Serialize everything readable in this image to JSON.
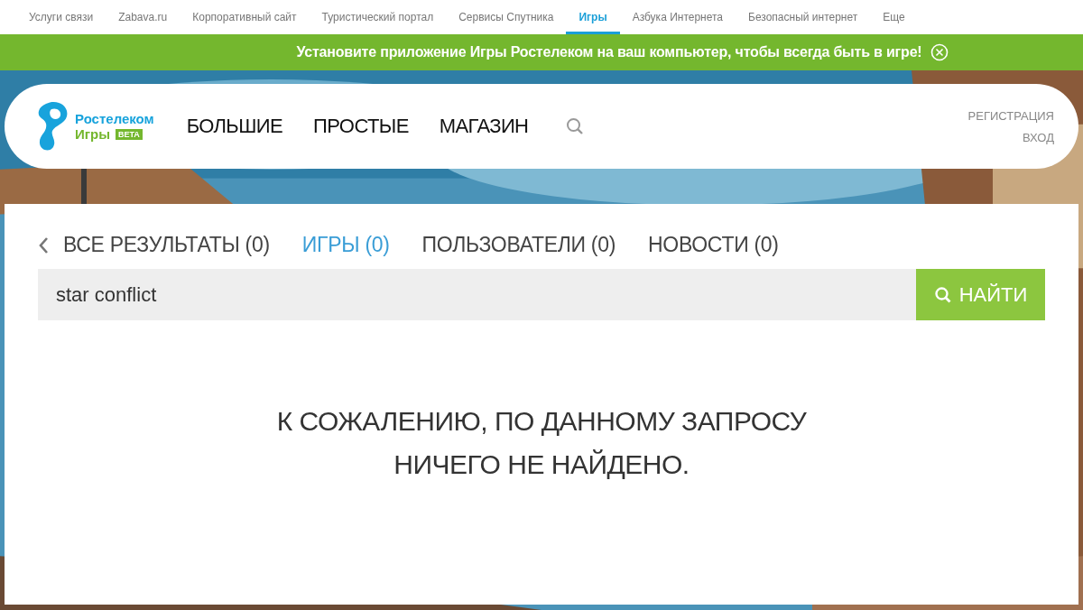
{
  "top_nav": [
    {
      "label": "Услуги связи",
      "selected": false
    },
    {
      "label": "Zabava.ru",
      "selected": false
    },
    {
      "label": "Корпоративный сайт",
      "selected": false
    },
    {
      "label": "Туристический портал",
      "selected": false
    },
    {
      "label": "Сервисы Спутника",
      "selected": false
    },
    {
      "label": "Игры",
      "selected": true
    },
    {
      "label": "Азбука Интернета",
      "selected": false
    },
    {
      "label": "Безопасный интернет",
      "selected": false
    },
    {
      "label": "Еще",
      "selected": false
    }
  ],
  "banner": {
    "text": "Установите приложение Игры Ростелеком на ваш компьютер, чтобы всегда быть в игре!"
  },
  "header": {
    "logo": {
      "brand": "Ростелеком",
      "product": "Игры",
      "badge": "BETA"
    },
    "menu": [
      "БОЛЬШИЕ",
      "ПРОСТЫЕ",
      "МАГАЗИН"
    ],
    "auth": [
      "РЕГИСТРАЦИЯ",
      "ВХОД"
    ]
  },
  "result_tabs": [
    {
      "label": "ВСЕ РЕЗУЛЬТАТЫ (0)",
      "selected": false
    },
    {
      "label": "ИГРЫ (0)",
      "selected": true
    },
    {
      "label": "ПОЛЬЗОВАТЕЛИ (0)",
      "selected": false
    },
    {
      "label": "НОВОСТИ (0)",
      "selected": false
    }
  ],
  "search": {
    "value": "star conflict",
    "button": "НАЙТИ"
  },
  "message": [
    "К СОЖАЛЕНИЮ, ПО ДАННОМУ ЗАПРОСУ",
    "НИЧЕГО НЕ НАЙДЕНО."
  ]
}
